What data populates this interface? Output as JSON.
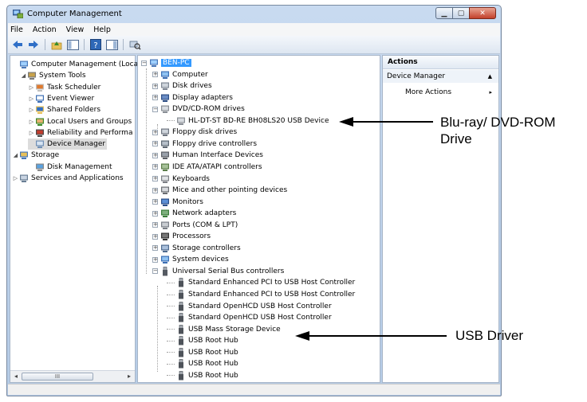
{
  "window": {
    "title": "Computer Management"
  },
  "menubar": [
    "File",
    "Action",
    "View",
    "Help"
  ],
  "left_tree": [
    {
      "label": "Computer Management (Local",
      "indent": 0,
      "exp": "",
      "icon": "computer-management-icon"
    },
    {
      "label": "System Tools",
      "indent": 1,
      "exp": "◢",
      "icon": "tools-icon"
    },
    {
      "label": "Task Scheduler",
      "indent": 2,
      "exp": "▷",
      "icon": "clock-icon"
    },
    {
      "label": "Event Viewer",
      "indent": 2,
      "exp": "▷",
      "icon": "event-viewer-icon"
    },
    {
      "label": "Shared Folders",
      "indent": 2,
      "exp": "▷",
      "icon": "shared-folders-icon"
    },
    {
      "label": "Local Users and Groups",
      "indent": 2,
      "exp": "▷",
      "icon": "users-icon"
    },
    {
      "label": "Reliability and Performa",
      "indent": 2,
      "exp": "▷",
      "icon": "performance-icon"
    },
    {
      "label": "Device Manager",
      "indent": 2,
      "exp": "",
      "icon": "device-manager-icon",
      "selected": true
    },
    {
      "label": "Storage",
      "indent": 0,
      "exp": "◢",
      "icon": "storage-icon"
    },
    {
      "label": "Disk Management",
      "indent": 2,
      "exp": "",
      "icon": "disk-management-icon"
    },
    {
      "label": "Services and Applications",
      "indent": 0,
      "exp": "▷",
      "icon": "services-icon"
    }
  ],
  "device_tree": [
    {
      "label": "BEN-PC",
      "level": 0,
      "pm": "−",
      "icon": "pc-icon",
      "selected": true
    },
    {
      "label": "Computer",
      "level": 1,
      "pm": "+",
      "icon": "computer-icon"
    },
    {
      "label": "Disk drives",
      "level": 1,
      "pm": "+",
      "icon": "disk-drive-icon"
    },
    {
      "label": "Display adapters",
      "level": 1,
      "pm": "+",
      "icon": "display-adapter-icon"
    },
    {
      "label": "DVD/CD-ROM drives",
      "level": 1,
      "pm": "−",
      "icon": "dvd-drive-icon"
    },
    {
      "label": "HL-DT-ST BD-RE  BH08LS20 USB Device",
      "level": 2,
      "pm": "",
      "icon": "dvd-device-icon"
    },
    {
      "label": "Floppy disk drives",
      "level": 1,
      "pm": "+",
      "icon": "floppy-disk-icon"
    },
    {
      "label": "Floppy drive controllers",
      "level": 1,
      "pm": "+",
      "icon": "floppy-controller-icon"
    },
    {
      "label": "Human Interface Devices",
      "level": 1,
      "pm": "+",
      "icon": "hid-icon"
    },
    {
      "label": "IDE ATA/ATAPI controllers",
      "level": 1,
      "pm": "+",
      "icon": "ide-controller-icon"
    },
    {
      "label": "Keyboards",
      "level": 1,
      "pm": "+",
      "icon": "keyboard-icon"
    },
    {
      "label": "Mice and other pointing devices",
      "level": 1,
      "pm": "+",
      "icon": "mouse-icon"
    },
    {
      "label": "Monitors",
      "level": 1,
      "pm": "+",
      "icon": "monitor-icon"
    },
    {
      "label": "Network adapters",
      "level": 1,
      "pm": "+",
      "icon": "network-adapter-icon"
    },
    {
      "label": "Ports (COM & LPT)",
      "level": 1,
      "pm": "+",
      "icon": "port-icon"
    },
    {
      "label": "Processors",
      "level": 1,
      "pm": "+",
      "icon": "processor-icon"
    },
    {
      "label": "Storage controllers",
      "level": 1,
      "pm": "+",
      "icon": "storage-controller-icon"
    },
    {
      "label": "System devices",
      "level": 1,
      "pm": "+",
      "icon": "system-devices-icon"
    },
    {
      "label": "Universal Serial Bus controllers",
      "level": 1,
      "pm": "−",
      "icon": "usb-icon"
    },
    {
      "label": "Standard Enhanced PCI to USB Host Controller",
      "level": 2,
      "pm": "",
      "icon": "usb-plug-icon"
    },
    {
      "label": "Standard Enhanced PCI to USB Host Controller",
      "level": 2,
      "pm": "",
      "icon": "usb-plug-icon"
    },
    {
      "label": "Standard OpenHCD USB Host Controller",
      "level": 2,
      "pm": "",
      "icon": "usb-plug-icon"
    },
    {
      "label": "Standard OpenHCD USB Host Controller",
      "level": 2,
      "pm": "",
      "icon": "usb-plug-icon"
    },
    {
      "label": "USB Mass Storage Device",
      "level": 2,
      "pm": "",
      "icon": "usb-plug-icon"
    },
    {
      "label": "USB Root Hub",
      "level": 2,
      "pm": "",
      "icon": "usb-plug-icon"
    },
    {
      "label": "USB Root Hub",
      "level": 2,
      "pm": "",
      "icon": "usb-plug-icon"
    },
    {
      "label": "USB Root Hub",
      "level": 2,
      "pm": "",
      "icon": "usb-plug-icon"
    },
    {
      "label": "USB Root Hub",
      "level": 2,
      "pm": "",
      "icon": "usb-plug-icon"
    }
  ],
  "actions": {
    "header": "Actions",
    "section": "Device Manager",
    "more": "More Actions"
  },
  "scroll": {
    "thumb_label": "III"
  },
  "callouts": {
    "bluray_line1": "Blu-ray/ DVD-ROM",
    "bluray_line2": "Drive",
    "usb": "USB Driver"
  }
}
